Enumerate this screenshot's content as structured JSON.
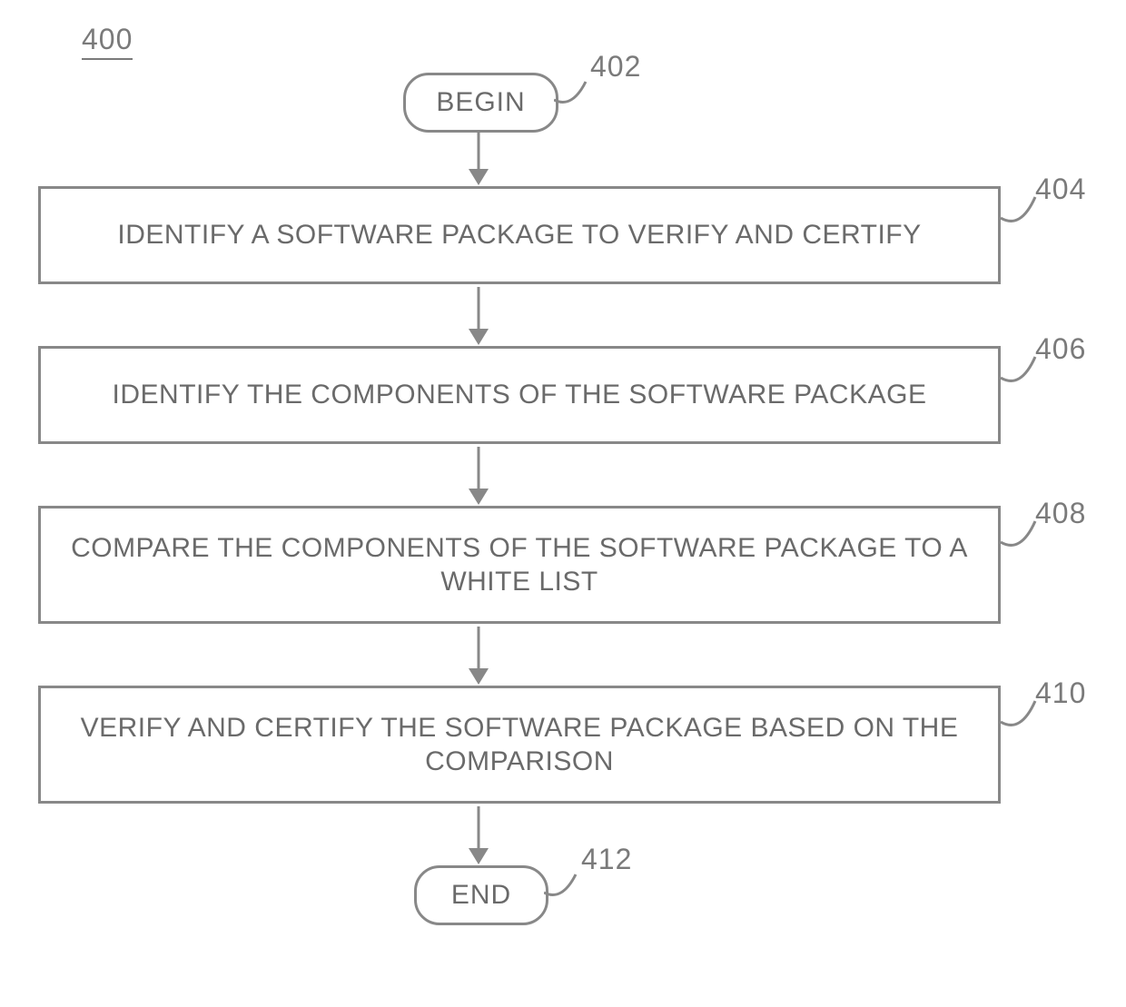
{
  "figure_number": "400",
  "terminals": {
    "begin": {
      "label": "BEGIN",
      "ref": "402"
    },
    "end": {
      "label": "END",
      "ref": "412"
    }
  },
  "steps": [
    {
      "ref": "404",
      "text": "IDENTIFY A SOFTWARE PACKAGE TO VERIFY AND CERTIFY"
    },
    {
      "ref": "406",
      "text": "IDENTIFY THE COMPONENTS OF THE SOFTWARE PACKAGE"
    },
    {
      "ref": "408",
      "text": "COMPARE THE COMPONENTS OF THE SOFTWARE PACKAGE TO A WHITE LIST"
    },
    {
      "ref": "410",
      "text": "VERIFY AND CERTIFY THE SOFTWARE PACKAGE BASED ON THE COMPARISON"
    }
  ]
}
